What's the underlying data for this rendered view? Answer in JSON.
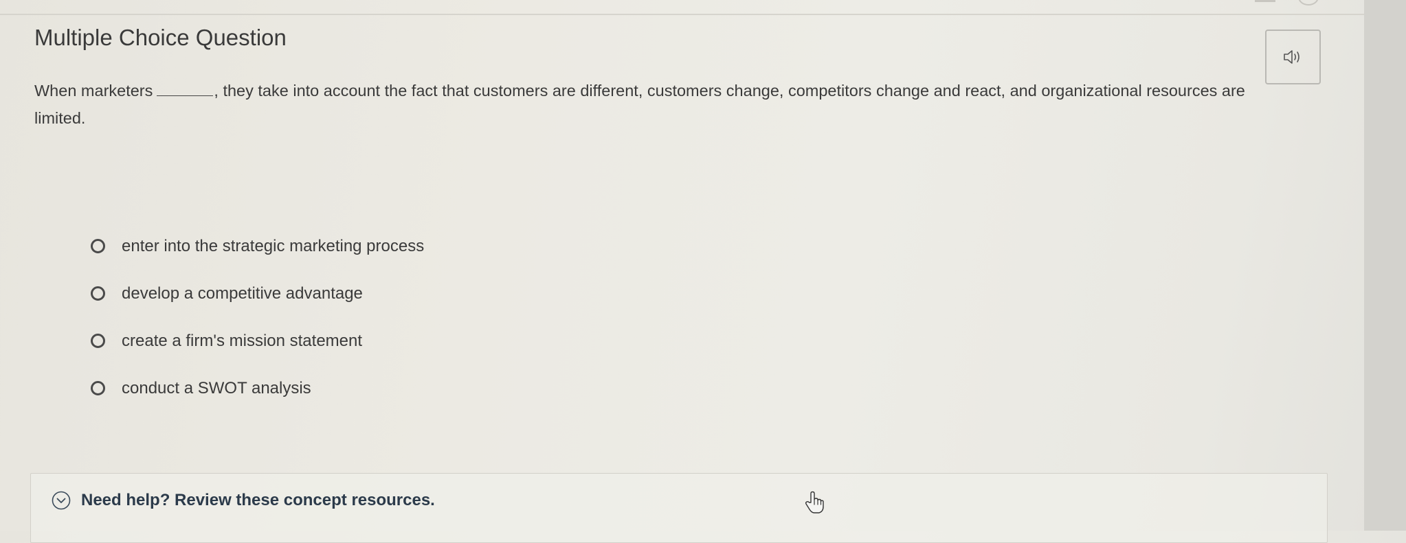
{
  "question": {
    "heading": "Multiple Choice Question",
    "prompt_before_blank": "When marketers",
    "prompt_after_blank": ", they take into account the fact that customers are different, customers change, competitors change and react, and organizational resources are limited."
  },
  "choices": [
    {
      "label": "enter into the strategic marketing process"
    },
    {
      "label": "develop a competitive advantage"
    },
    {
      "label": "create a firm's mission statement"
    },
    {
      "label": "conduct a SWOT analysis"
    }
  ],
  "help": {
    "label": "Need help? Review these concept resources."
  },
  "icons": {
    "audio": "speaker-icon",
    "help_toggle": "chevron-down-circle-icon",
    "cursor": "hand-pointer-icon"
  },
  "colors": {
    "heading_text": "#3a3a3a",
    "help_text": "#2b3a4a",
    "background": "#eceae3",
    "right_bar": "#d3d2cd"
  }
}
